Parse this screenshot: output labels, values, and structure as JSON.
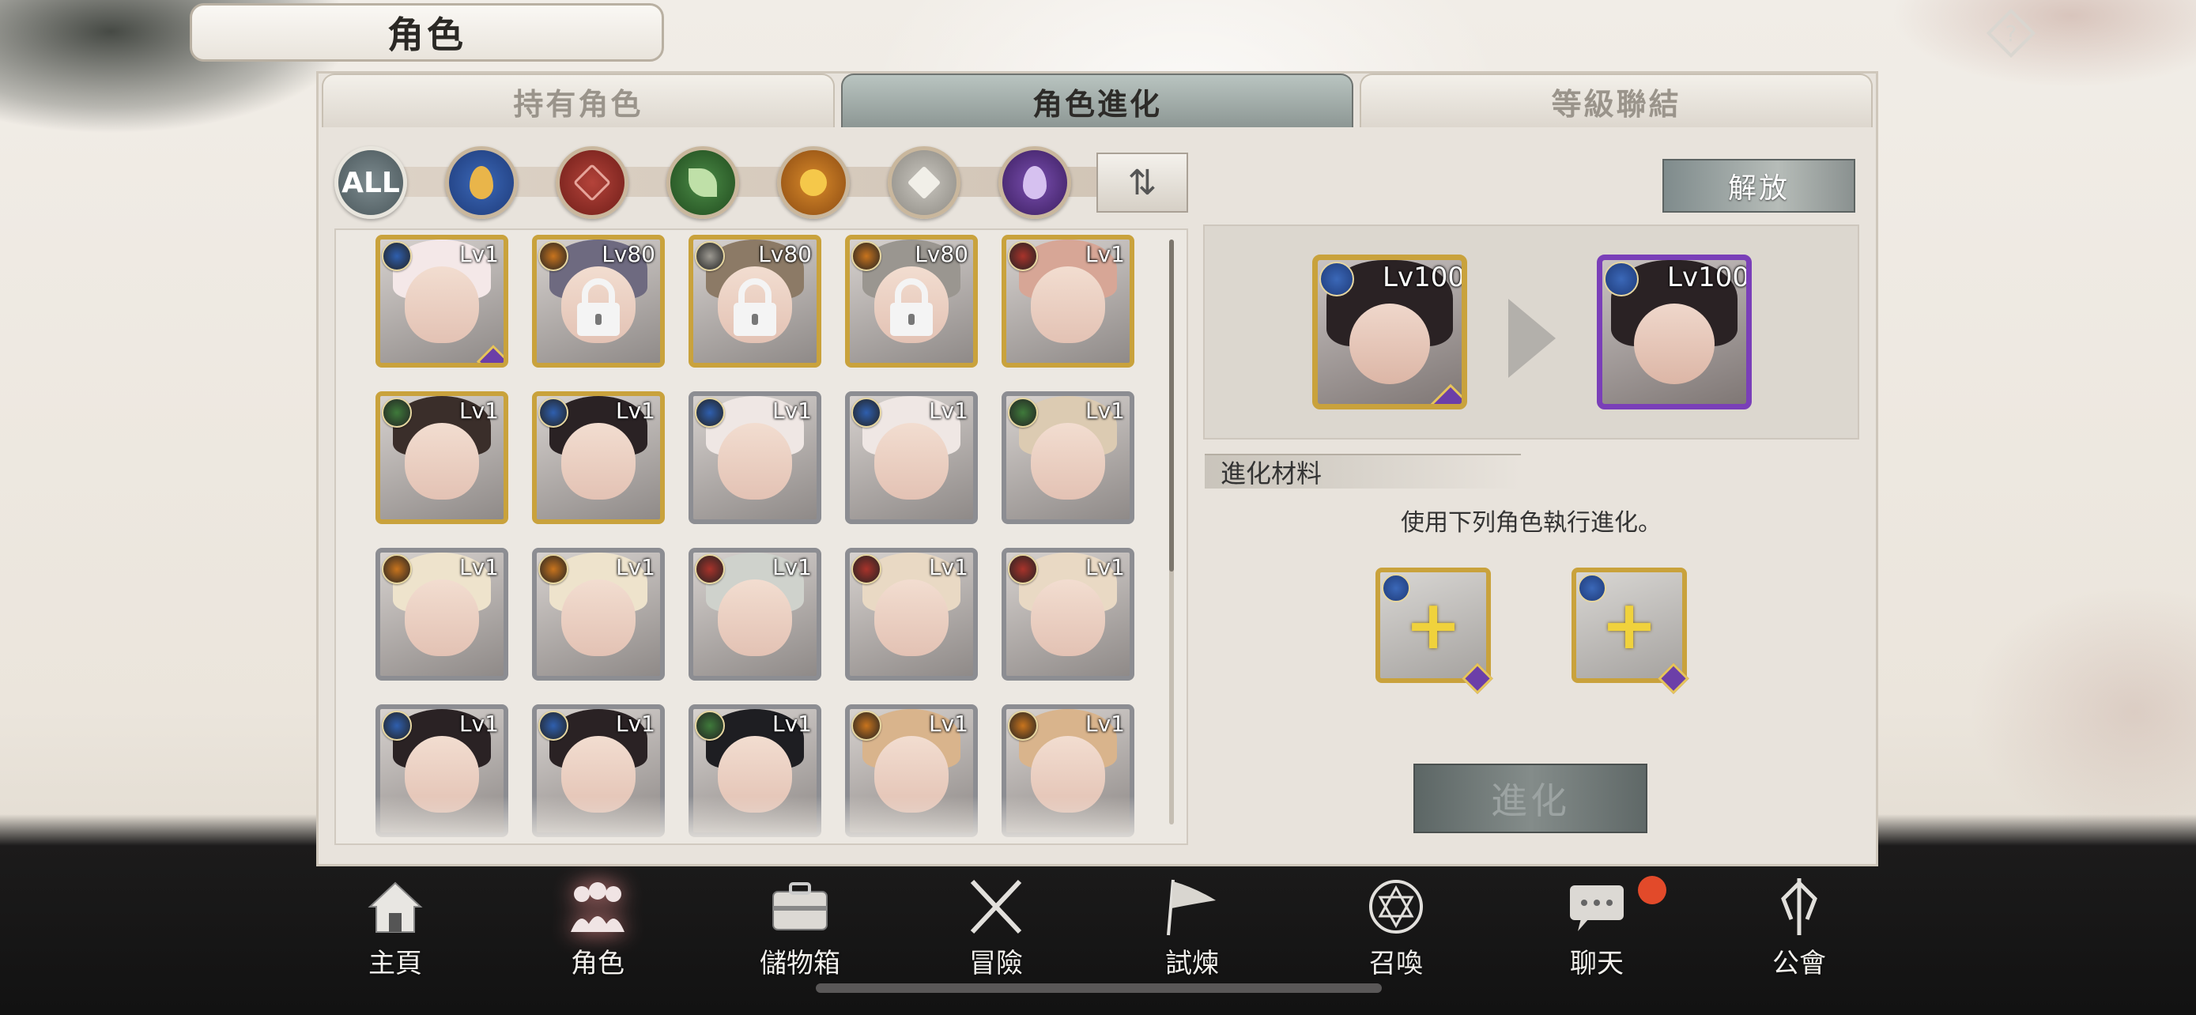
{
  "screen_title": "角色",
  "tabs": [
    {
      "label": "持有角色",
      "active": false
    },
    {
      "label": "角色進化",
      "active": true
    },
    {
      "label": "等級聯結",
      "active": false
    }
  ],
  "filters": {
    "all_label": "ALL",
    "elements": [
      "water",
      "fire",
      "wind",
      "sun",
      "light",
      "dark"
    ],
    "sort_icon": "sort-arrows-icon"
  },
  "grid": {
    "cards": [
      {
        "lv": "Lv1",
        "element": "water",
        "frame": "gold",
        "locked": false,
        "hair": "#f4e8e8"
      },
      {
        "lv": "Lv80",
        "element": "sun",
        "frame": "gold",
        "locked": true,
        "hair": "#6e6a80"
      },
      {
        "lv": "Lv80",
        "element": "light",
        "frame": "gold",
        "locked": true,
        "hair": "#8c7a66"
      },
      {
        "lv": "Lv80",
        "element": "sun",
        "frame": "gold",
        "locked": true,
        "hair": "#9a9690"
      },
      {
        "lv": "Lv1",
        "element": "fire",
        "frame": "gold",
        "locked": false,
        "hair": "#d7a696"
      },
      {
        "lv": "Lv1",
        "element": "wind",
        "frame": "gold",
        "locked": false,
        "hair": "#3a2e2a"
      },
      {
        "lv": "Lv1",
        "element": "water",
        "frame": "gold",
        "locked": false,
        "hair": "#2a2224"
      },
      {
        "lv": "Lv1",
        "element": "water",
        "frame": "silver",
        "locked": false,
        "hair": "#efe7e4"
      },
      {
        "lv": "Lv1",
        "element": "water",
        "frame": "silver",
        "locked": false,
        "hair": "#efe7e4"
      },
      {
        "lv": "Lv1",
        "element": "wind",
        "frame": "silver",
        "locked": false,
        "hair": "#dccbb2"
      },
      {
        "lv": "Lv1",
        "element": "sun",
        "frame": "silver",
        "locked": false,
        "hair": "#eee3cc"
      },
      {
        "lv": "Lv1",
        "element": "sun",
        "frame": "silver",
        "locked": false,
        "hair": "#eee3cc"
      },
      {
        "lv": "Lv1",
        "element": "fire",
        "frame": "silver",
        "locked": false,
        "hair": "#cfd2cc"
      },
      {
        "lv": "Lv1",
        "element": "fire",
        "frame": "silver",
        "locked": false,
        "hair": "#e9d9c4"
      },
      {
        "lv": "Lv1",
        "element": "fire",
        "frame": "silver",
        "locked": false,
        "hair": "#e9d9c4"
      },
      {
        "lv": "Lv1",
        "element": "water",
        "frame": "silver",
        "locked": false,
        "hair": "#2a2224"
      },
      {
        "lv": "Lv1",
        "element": "water",
        "frame": "silver",
        "locked": false,
        "hair": "#2a2224"
      },
      {
        "lv": "Lv1",
        "element": "wind",
        "frame": "silver",
        "locked": false,
        "hair": "#1e1e22"
      },
      {
        "lv": "Lv1",
        "element": "sun",
        "frame": "silver",
        "locked": false,
        "hair": "#d9b48c"
      },
      {
        "lv": "Lv1",
        "element": "sun",
        "frame": "silver",
        "locked": false,
        "hair": "#d9b48c"
      }
    ]
  },
  "release_button": "解放",
  "evolution": {
    "before_lv": "Lv100",
    "after_lv": "Lv100",
    "materials_label": "進化材料",
    "instruction": "使用下列角色執行進化。",
    "evolve_button": "進化"
  },
  "nav": [
    {
      "label": "主頁",
      "icon": "home-icon",
      "active": false
    },
    {
      "label": "角色",
      "icon": "characters-icon",
      "active": true
    },
    {
      "label": "儲物箱",
      "icon": "storage-box-icon",
      "active": false
    },
    {
      "label": "冒險",
      "icon": "crossed-swords-icon",
      "active": false
    },
    {
      "label": "試煉",
      "icon": "flag-icon",
      "active": false
    },
    {
      "label": "召喚",
      "icon": "summon-circle-icon",
      "active": false
    },
    {
      "label": "聊天",
      "icon": "chat-icon",
      "active": false
    },
    {
      "label": "公會",
      "icon": "guild-icon",
      "active": false
    }
  ],
  "colors": {
    "water": "#2f5fae",
    "fire": "#a8332b",
    "wind": "#3f7a3b",
    "sun": "#c8741e",
    "light": "#9d9a92",
    "dark": "#6a3f96",
    "gold_frame": "#c9a23c",
    "notification": "#e24a2a"
  }
}
